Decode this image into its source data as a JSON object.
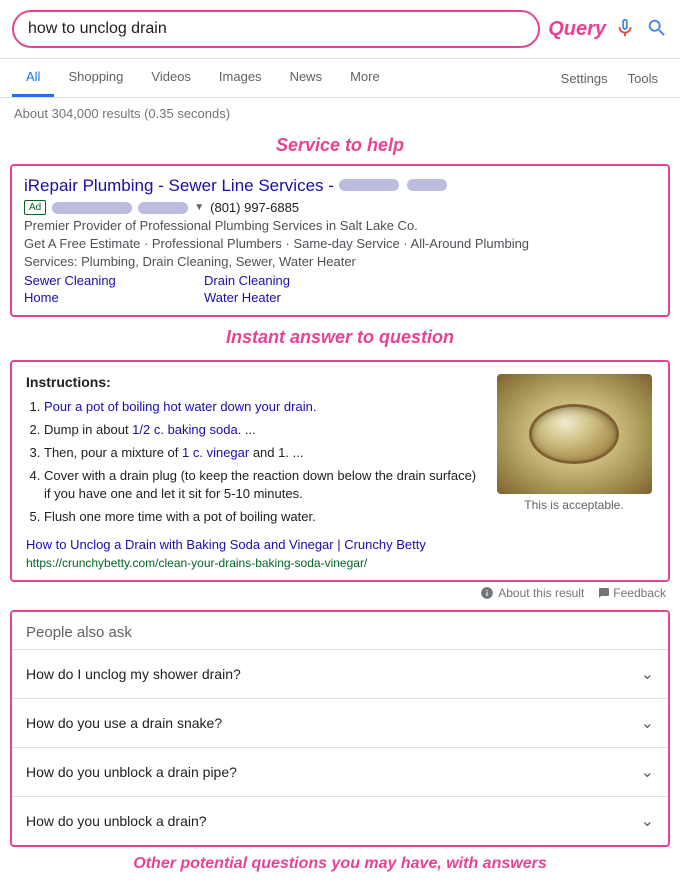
{
  "search": {
    "query": "how to unclog drain",
    "query_label": "Query",
    "placeholder": "how to unclog drain"
  },
  "nav": {
    "tabs": [
      "All",
      "Shopping",
      "Videos",
      "Images",
      "News",
      "More"
    ],
    "right_tabs": [
      "Settings",
      "Tools"
    ],
    "active_tab": "All"
  },
  "results_count": "About 304,000 results (0.35 seconds)",
  "service_annotation": "Service to help",
  "ad": {
    "title": "iRepair Plumbing - Sewer Line Services -",
    "ad_badge": "Ad",
    "phone": "(801) 997-6885",
    "description": "Premier Provider of Professional Plumbing Services in Salt Lake Co.",
    "sub_links_label": "Services: Plumbing, Drain Cleaning, Sewer, Water Heater",
    "links": [
      {
        "col": 0,
        "text": "Sewer Cleaning",
        "url": "#"
      },
      {
        "col": 0,
        "text": "Home",
        "url": "#"
      },
      {
        "col": 1,
        "text": "Drain Cleaning",
        "url": "#"
      },
      {
        "col": 1,
        "text": "Water Heater",
        "url": "#"
      }
    ],
    "extra1": "Get A Free Estimate · Professional Plumbers · Same-day Service · All-Around Plumbing"
  },
  "instant_annotation": "Instant answer to question",
  "instant": {
    "title": "Instructions:",
    "steps": [
      "Pour a pot of boiling hot water down your drain.",
      "Dump in about 1/2 c. baking soda. ...",
      "Then, pour a mixture of 1 c. vinegar and 1. ...",
      "Cover with a drain plug (to keep the reaction down below the drain surface) if you have one and let it sit for 5-10 minutes.",
      "Flush one more time with a pot of boiling water."
    ],
    "source_link_text": "How to Unclog a Drain with Baking Soda and Vinegar | Crunchy Betty",
    "source_url": "https://crunchybetty.com/clean-your-drains-baking-soda-vinegar/",
    "image_caption": "This is acceptable.",
    "about_text": "About this result",
    "feedback_text": "Feedback"
  },
  "paa": {
    "header": "People also ask",
    "questions": [
      "How do I unclog my shower drain?",
      "How do you use a drain snake?",
      "How do you unblock a drain pipe?",
      "How do you unblock a drain?"
    ]
  },
  "bottom_annotation": "Other potential questions you may have, with answers"
}
